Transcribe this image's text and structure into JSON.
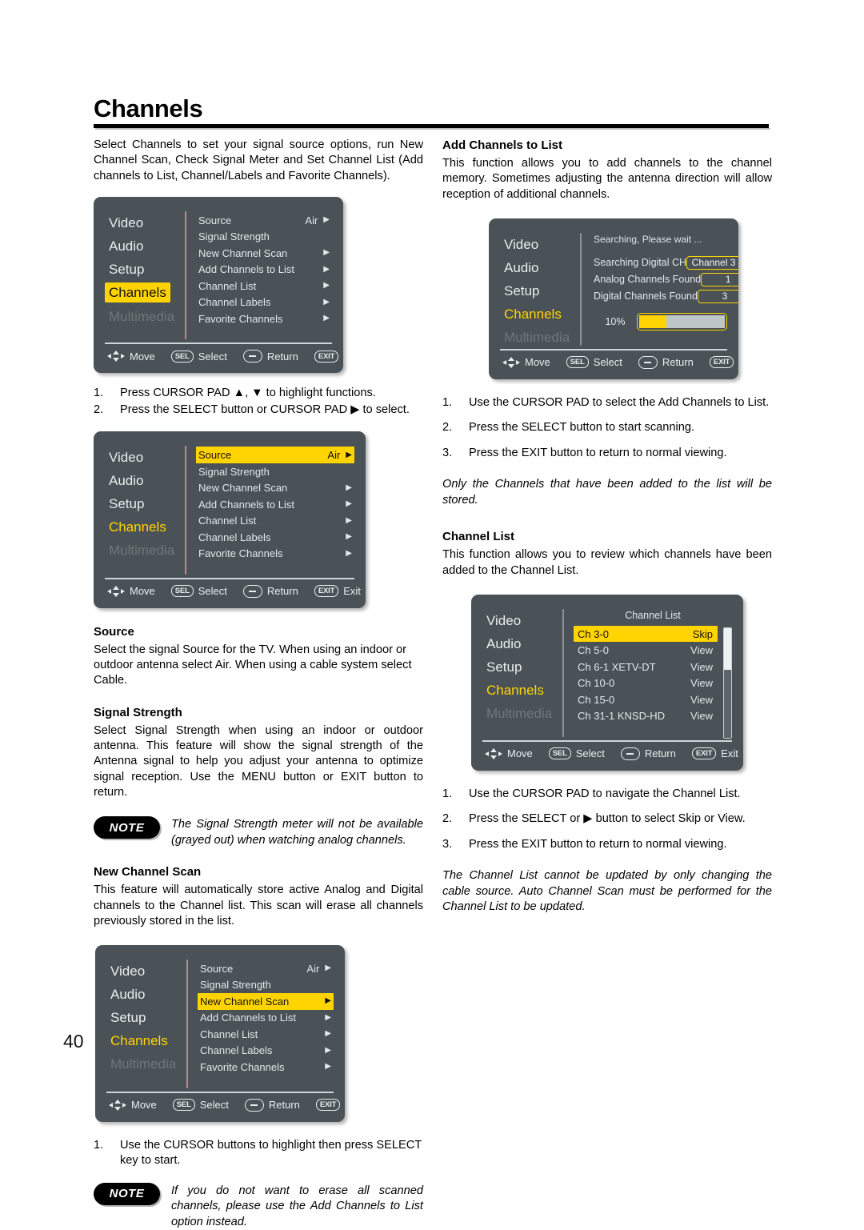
{
  "page": {
    "title": "Channels",
    "number": "40"
  },
  "intro": "Select Channels to set your signal source options, run New Channel Scan, Check Signal Meter and Set Channel List (Add channels to List, Channel/Labels and Favorite Channels).",
  "osd_common": {
    "categories": [
      "Video",
      "Audio",
      "Setup",
      "Channels",
      "Multimedia"
    ],
    "hints": {
      "move": "Move",
      "select": "Select",
      "return": "Return",
      "exit": "Exit",
      "sel_key": "SEL",
      "exit_key": "EXIT"
    },
    "menu_rows": [
      {
        "label": "Source",
        "value": "Air",
        "arrow": "▶"
      },
      {
        "label": "Signal Strength",
        "value": "",
        "arrow": ""
      },
      {
        "label": "New Channel Scan",
        "value": "",
        "arrow": "▶"
      },
      {
        "label": "Add Channels to List",
        "value": "",
        "arrow": "▶"
      },
      {
        "label": "Channel List",
        "value": "",
        "arrow": "▶"
      },
      {
        "label": "Channel Labels",
        "value": "",
        "arrow": "▶"
      },
      {
        "label": "Favorite Channels",
        "value": "",
        "arrow": "▶"
      }
    ]
  },
  "steps_after_menu1": [
    {
      "num": "1.",
      "text": "Press CURSOR PAD ▲, ▼ to highlight functions."
    },
    {
      "num": "2.",
      "text": "Press the SELECT button or CURSOR PAD ▶ to select."
    }
  ],
  "source": {
    "heading": "Source",
    "body": "Select the signal Source for the TV. When using an indoor or outdoor antenna select Air. When using a cable system select Cable."
  },
  "signal_strength": {
    "heading": "Signal Strength",
    "body": "Select Signal Strength when using an indoor or outdoor antenna. This feature will show the signal strength of the Antenna signal to help you adjust your antenna to optimize signal reception. Use the MENU button or EXIT button to return.",
    "note_badge": "NOTE",
    "note_text": "The Signal Strength meter will not be available (grayed out) when watching analog channels."
  },
  "new_channel_scan": {
    "heading": "New Channel Scan",
    "body": "This feature will automatically store active Analog and Digital channels to the Channel list. This scan will erase all channels previously stored in the list.",
    "steps": [
      {
        "num": "1.",
        "text": "Use the CURSOR buttons to highlight then press SELECT key to start."
      }
    ],
    "note_badge": "NOTE",
    "note_text": "If you do not want to erase all scanned channels, please use the Add Channels to List option instead."
  },
  "add_channels": {
    "heading": "Add Channels to List",
    "body": "This function allows you to add channels to the channel memory. Sometimes adjusting the antenna direction will allow reception of additional channels.",
    "osd": {
      "searching_text": "Searching, Please wait ...",
      "rows": [
        {
          "key": "Searching Digital CH",
          "value": "Channel 3"
        },
        {
          "key": "Analog Channels Found",
          "value": "1"
        },
        {
          "key": "Digital Channels Found",
          "value": "3"
        }
      ],
      "percent_label": "10%",
      "percent_value": 10
    },
    "steps": [
      {
        "num": "1.",
        "text": "Use the CURSOR PAD to select the Add Channels to List."
      },
      {
        "num": "2.",
        "text": "Press the SELECT button to start scanning."
      },
      {
        "num": "3.",
        "text": "Press the EXIT button to return to normal viewing."
      }
    ],
    "italic_note": "Only the Channels that have been added to the list  will be stored."
  },
  "channel_list": {
    "heading": "Channel List",
    "body": "This function allows you to review which channels have been added to the Channel List.",
    "osd": {
      "title": "Channel List",
      "rows": [
        {
          "channel": "Ch 3-0",
          "state": "Skip",
          "selected": true
        },
        {
          "channel": "Ch 5-0",
          "state": "View",
          "selected": false
        },
        {
          "channel": "Ch 6-1 XETV-DT",
          "state": "View",
          "selected": false
        },
        {
          "channel": "Ch 10-0",
          "state": "View",
          "selected": false
        },
        {
          "channel": "Ch 15-0",
          "state": "View",
          "selected": false
        },
        {
          "channel": "Ch 31-1 KNSD-HD",
          "state": "View",
          "selected": false
        }
      ]
    },
    "steps": [
      {
        "num": "1.",
        "text": "Use the CURSOR PAD to navigate the Channel List."
      },
      {
        "num": "2.",
        "text": "Press the SELECT or ▶ button to select Skip or View."
      },
      {
        "num": "3.",
        "text": "Press the EXIT button to return to normal viewing."
      }
    ],
    "italic_note": "The Channel List cannot be updated by only changing the cable source. Auto Channel Scan must be performed for the Channel List to be updated."
  },
  "colors": {
    "osd_background": "#4a5257",
    "highlight_yellow": "#ffd400",
    "dim_text": "#6f7679",
    "text": "#e6eaec"
  }
}
